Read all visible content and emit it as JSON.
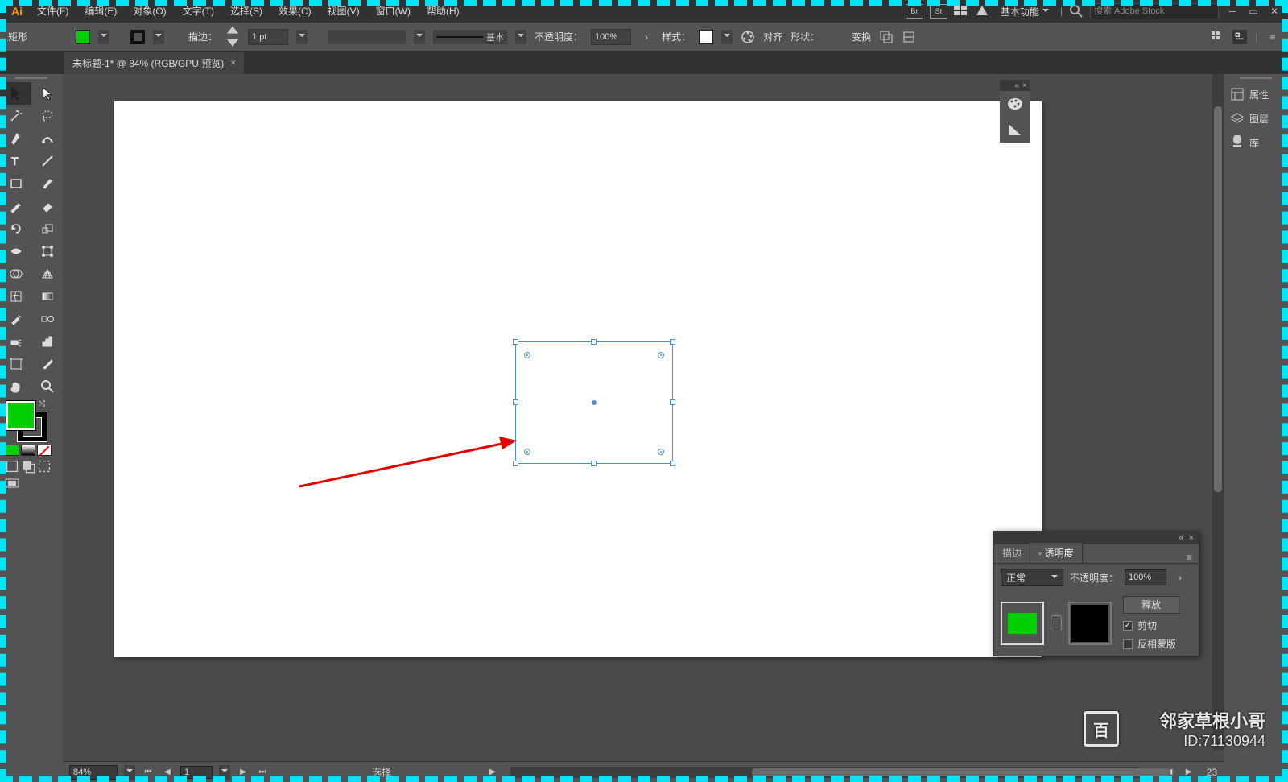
{
  "app": {
    "logo": "Ai"
  },
  "menu": {
    "file": "文件(F)",
    "edit": "编辑(E)",
    "object": "对象(O)",
    "type": "文字(T)",
    "select": "选择(S)",
    "effect": "效果(C)",
    "view": "视图(V)",
    "window": "窗口(W)",
    "help": "帮助(H)"
  },
  "workspace": {
    "label": "基本功能"
  },
  "search": {
    "placeholder": "搜索 Adobe Stock"
  },
  "control": {
    "tool_name": "矩形",
    "stroke_label": "描边：",
    "stroke_weight": "1 pt",
    "stroke_style": "基本",
    "opacity_label": "不透明度：",
    "opacity_value": "100%",
    "style_label": "样式：",
    "align_label": "对齐",
    "shape_label": "形状：",
    "transform_label": "变换"
  },
  "doc_tab": {
    "title": "未标题-1* @ 84% (RGB/GPU 预览)",
    "close": "×"
  },
  "right_panel": {
    "properties": "属性",
    "layers": "图层",
    "libraries": "库"
  },
  "mini_panel": {
    "collapse": "«",
    "close": "×"
  },
  "transparency": {
    "tab_stroke": "描边",
    "tab_trans": "◦ 透明度",
    "blend_mode": "正常",
    "opacity_label": "不透明度：",
    "opacity_value": "100%",
    "release": "释放",
    "clip": "剪切",
    "invert": "反相蒙版",
    "collapse": "«",
    "close": "×",
    "menu": "≡"
  },
  "status": {
    "zoom": "84%",
    "artboard": "1",
    "tool": "选择",
    "page_count": "23"
  },
  "colors": {
    "accent_green": "#00d000",
    "selection_blue": "#4a90d9"
  },
  "watermark": {
    "name": "邻家草根小哥",
    "id": "ID:71130944",
    "badge": "百"
  }
}
